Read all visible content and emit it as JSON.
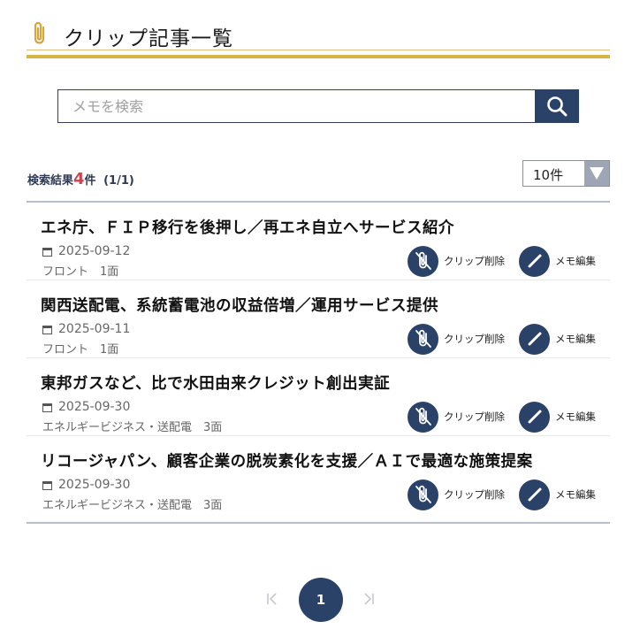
{
  "page": {
    "title": "クリップ記事一覧",
    "title_icon": "paperclip-icon"
  },
  "search": {
    "placeholder": "メモを検索",
    "value": "",
    "button_icon": "search-icon"
  },
  "results": {
    "prefix": "検索結果",
    "count": "4",
    "suffix": "件",
    "page_info": "(1/1)"
  },
  "per_page": {
    "selected": "10件"
  },
  "articles": [
    {
      "title": "エネ庁、ＦＩＰ移行を後押し／再エネ自立へサービス紹介",
      "date": "2025-09-12",
      "meta": "フロント　1面",
      "unclip_label": "クリップ削除",
      "memo_label": "メモ編集"
    },
    {
      "title": "関西送配電、系統蓄電池の収益倍増／運用サービス提供",
      "date": "2025-09-11",
      "meta": "フロント　1面",
      "unclip_label": "クリップ削除",
      "memo_label": "メモ編集"
    },
    {
      "title": "東邦ガスなど、比で水田由来クレジット創出実証",
      "date": "2025-09-30",
      "meta": "エネルギービジネス・送配電　3面",
      "unclip_label": "クリップ削除",
      "memo_label": "メモ編集"
    },
    {
      "title": "リコージャパン、顧客企業の脱炭素化を支援／ＡＩで最適な施策提案",
      "date": "2025-09-30",
      "meta": "エネルギービジネス・送配電　3面",
      "unclip_label": "クリップ削除",
      "memo_label": "メモ編集"
    }
  ],
  "pagination": {
    "current": "1",
    "first_icon": "first-page-icon",
    "last_icon": "last-page-icon"
  },
  "colors": {
    "primary": "#2a4268",
    "accent_gold": "#d4b545",
    "count_red": "#c8454f"
  }
}
